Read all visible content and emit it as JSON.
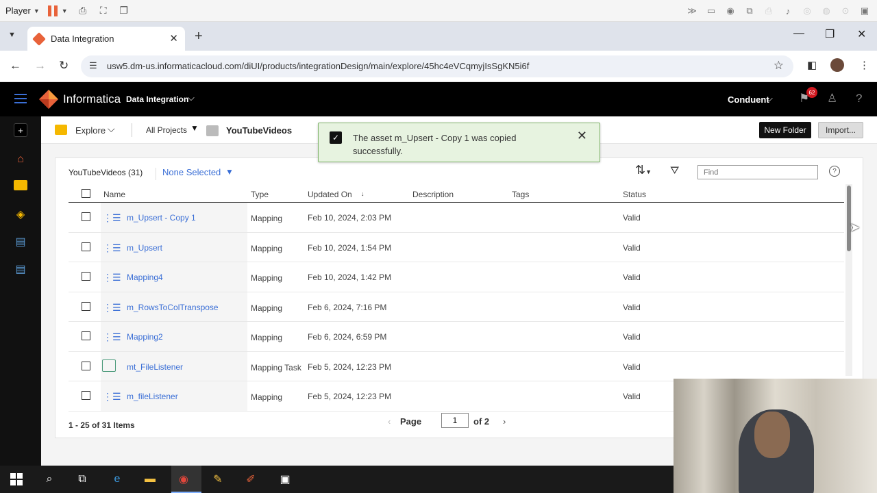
{
  "player": {
    "label": "Player"
  },
  "browser": {
    "tab_title": "Data Integration",
    "url": "usw5.dm-us.informaticacloud.com/diUI/products/integrationDesign/main/explore/45hc4eVCqmyjIsSgKN5i6f"
  },
  "header": {
    "brand": "Informatica",
    "product": "Data Integration",
    "org": "Conduent",
    "notifications": "62"
  },
  "explore": {
    "explore_label": "Explore",
    "all_projects": "All Projects",
    "project_name": "YouTubeVideos",
    "new_folder": "New Folder",
    "import": "Import..."
  },
  "toast": {
    "message": "The asset m_Upsert - Copy 1 was copied successfully."
  },
  "grid": {
    "folder_title": "YouTubeVideos (31)",
    "selection": "None Selected",
    "find_placeholder": "Find",
    "columns": [
      "Name",
      "Type",
      "Updated On",
      "Description",
      "Tags",
      "Status"
    ],
    "rows": [
      {
        "name": "m_Upsert - Copy 1",
        "type": "Mapping",
        "updated": "Feb 10, 2024, 2:03 PM",
        "status": "Valid",
        "icon": "mapping-icon"
      },
      {
        "name": "m_Upsert",
        "type": "Mapping",
        "updated": "Feb 10, 2024, 1:54 PM",
        "status": "Valid",
        "icon": "mapping-icon"
      },
      {
        "name": "Mapping4",
        "type": "Mapping",
        "updated": "Feb 10, 2024, 1:42 PM",
        "status": "Valid",
        "icon": "mapping-icon"
      },
      {
        "name": "m_RowsToColTranspose",
        "type": "Mapping",
        "updated": "Feb 6, 2024, 7:16 PM",
        "status": "Valid",
        "icon": "mapping-icon"
      },
      {
        "name": "Mapping2",
        "type": "Mapping",
        "updated": "Feb 6, 2024, 6:59 PM",
        "status": "Valid",
        "icon": "mapping-icon"
      },
      {
        "name": "mt_FileListener",
        "type": "Mapping Task",
        "updated": "Feb 5, 2024, 12:23 PM",
        "status": "Valid",
        "icon": "mapping-task-icon"
      },
      {
        "name": "m_fileListener",
        "type": "Mapping",
        "updated": "Feb 5, 2024, 12:23 PM",
        "status": "Valid",
        "icon": "mapping-icon"
      }
    ]
  },
  "pager": {
    "range": "1 - 25 of 31 Items",
    "page_label": "Page",
    "page_value": "1",
    "of_label": "of 2"
  },
  "colors": {
    "accent": "#3b6fd6",
    "brand": "#e8623a",
    "toast_bg": "#e7f3e0"
  }
}
